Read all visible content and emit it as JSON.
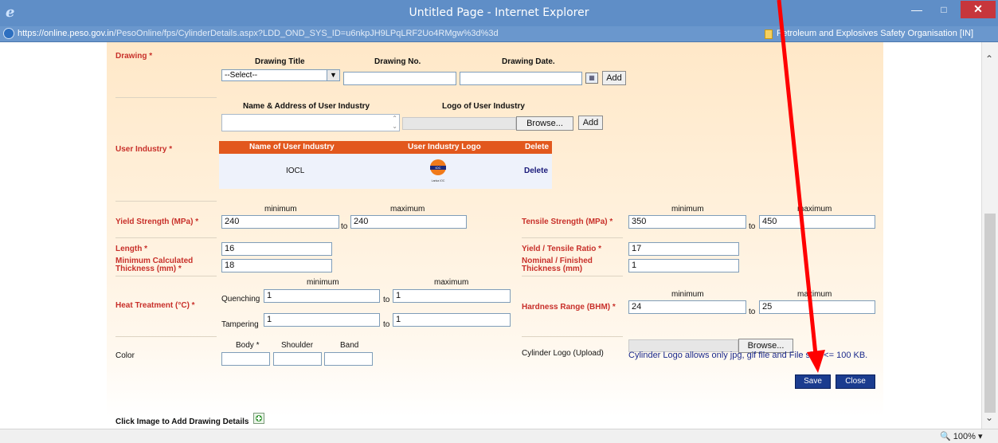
{
  "window": {
    "title": "Untitled Page - Internet Explorer",
    "url_host": "https://online.peso.gov.in",
    "url_path": "/PesoOnline/fps/CylinderDetails.aspx?LDD_OND_SYS_ID=u6nkpJH9LPqLRF2Uo4RMgw%3d%3d",
    "cert_label": "Petroleum and Explosives Safety Organisation [IN]",
    "zoom": "100%"
  },
  "drawing": {
    "label": "Drawing *",
    "title_header": "Drawing Title",
    "no_header": "Drawing No.",
    "date_header": "Drawing Date.",
    "title_selected": "--Select--",
    "no_value": "",
    "date_value": "",
    "add_label": "Add"
  },
  "user_industry": {
    "name_header": "Name & Address of User Industry",
    "logo_header": "Logo of User Industry",
    "browse_label": "Browse...",
    "add_label": "Add",
    "label": "User Industry *",
    "grid_headers": [
      "Name of User Industry",
      "User Industry Logo",
      "Delete"
    ],
    "rows": [
      {
        "name": "IOCL",
        "logo_text": "IOC",
        "logo_caption": "Lanka IOC",
        "delete": "Delete"
      }
    ]
  },
  "strength": {
    "min_header": "minimum",
    "max_header": "maximum",
    "yield_label": "Yield Strength (MPa) *",
    "yield_min": "240",
    "yield_max": "240",
    "tensile_label": "Tensile Strength (MPa) *",
    "tensile_min": "350",
    "tensile_max": "450",
    "to": "to"
  },
  "dimensions": {
    "length_label": "Length *",
    "length_value": "16",
    "ratio_label": "Yield / Tensile Ratio *",
    "ratio_value": "17",
    "min_thick_label_1": "Minimum Calculated",
    "min_thick_label_2": "Thickness (mm) *",
    "min_thick_value": "18",
    "nom_thick_label_1": "Nominal / Finished",
    "nom_thick_label_2": "Thickness (mm)",
    "nom_thick_value": "1"
  },
  "heat": {
    "label": "Heat Treatment (°C) *",
    "quenching_label": "Quenching",
    "quenching_min": "1",
    "quenching_max": "1",
    "tampering_label": "Tampering",
    "tampering_min": "1",
    "tampering_max": "1",
    "hardness_label": "Hardness Range (BHM) *",
    "hardness_min": "24",
    "hardness_max": "25"
  },
  "color": {
    "label": "Color",
    "body_header": "Body *",
    "shoulder_header": "Shoulder",
    "band_header": "Band",
    "body_value": "",
    "shoulder_value": "",
    "band_value": ""
  },
  "cylinder_logo": {
    "label": "Cylinder Logo (Upload)",
    "browse_label": "Browse...",
    "note": "Cylinder Logo allows only jpg, gif file and File size <= 100 KB."
  },
  "actions": {
    "save_label": "Save",
    "close_label": "Close"
  },
  "footer": {
    "click_image_label": "Click Image to Add Drawing Details"
  },
  "colors": {
    "label_red": "#c8302a",
    "grid_header": "#e2581d",
    "button_blue": "#1b3c8f",
    "annotation_arrow": "#ff0000"
  }
}
